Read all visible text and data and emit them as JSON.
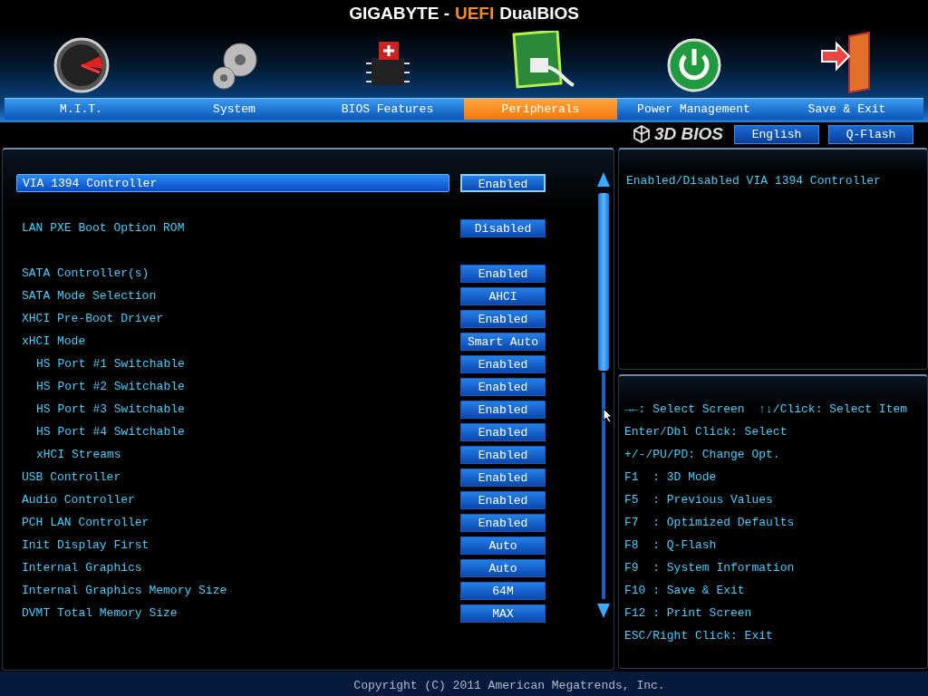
{
  "title": {
    "brand": "GIGABYTE -",
    "highlight": "UEFI",
    "product": "DualBIOS"
  },
  "tabs": [
    {
      "label": "M.I.T.",
      "selected": false
    },
    {
      "label": "System",
      "selected": false
    },
    {
      "label": "BIOS Features",
      "selected": false
    },
    {
      "label": "Peripherals",
      "selected": true
    },
    {
      "label": "Power Management",
      "selected": false
    },
    {
      "label": "Save & Exit",
      "selected": false
    }
  ],
  "toolbar": {
    "logo": "3D BIOS",
    "buttons": [
      "English",
      "Q-Flash"
    ]
  },
  "settings": [
    {
      "items": [
        {
          "name": "VIA 1394 Controller",
          "value": "Enabled",
          "selected": true
        }
      ]
    },
    {
      "items": [
        {
          "name": "LAN PXE Boot Option ROM",
          "value": "Disabled",
          "selected": false
        }
      ]
    },
    {
      "items": [
        {
          "name": "SATA Controller(s)",
          "value": "Enabled",
          "selected": false
        },
        {
          "name": "SATA Mode Selection",
          "value": "AHCI",
          "selected": false
        },
        {
          "name": "XHCI Pre-Boot Driver",
          "value": "Enabled",
          "selected": false
        },
        {
          "name": "xHCI Mode",
          "value": "Smart Auto",
          "selected": false,
          "children": [
            {
              "name": "HS Port #1 Switchable",
              "value": "Enabled",
              "selected": false
            },
            {
              "name": "HS Port #2 Switchable",
              "value": "Enabled",
              "selected": false
            },
            {
              "name": "HS Port #3 Switchable",
              "value": "Enabled",
              "selected": false
            },
            {
              "name": "HS Port #4 Switchable",
              "value": "Enabled",
              "selected": false
            },
            {
              "name": "xHCI Streams",
              "value": "Enabled",
              "selected": false
            }
          ]
        },
        {
          "name": "USB Controller",
          "value": "Enabled",
          "selected": false
        },
        {
          "name": "Audio Controller",
          "value": "Enabled",
          "selected": false
        },
        {
          "name": "PCH LAN Controller",
          "value": "Enabled",
          "selected": false
        },
        {
          "name": "Init Display First",
          "value": "Auto",
          "selected": false
        },
        {
          "name": "Internal Graphics",
          "value": "Auto",
          "selected": false
        },
        {
          "name": "Internal Graphics Memory Size",
          "value": "64M",
          "selected": false
        },
        {
          "name": "DVMT Total Memory Size",
          "value": "MAX",
          "selected": false
        }
      ]
    }
  ],
  "description": "Enabled/Disabled VIA 1394 Controller",
  "help": [
    "→←: Select Screen  ↑↓/Click: Select Item",
    "Enter/Dbl Click: Select",
    "+/-/PU/PD: Change Opt.",
    "F1  : 3D Mode",
    "F5  : Previous Values",
    "F7  : Optimized Defaults",
    "F8  : Q-Flash",
    "F9  : System Information",
    "F10 : Save & Exit",
    "F12 : Print Screen",
    "ESC/Right Click: Exit"
  ],
  "footer": "Copyright (C) 2011 American Megatrends, Inc."
}
